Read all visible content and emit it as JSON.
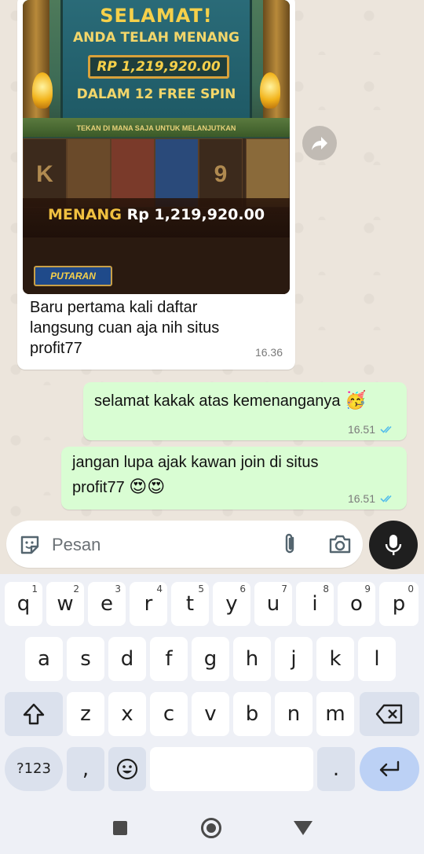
{
  "chat": {
    "incoming": {
      "image": {
        "headline": "SELAMAT!",
        "subtitle": "ANDA TELAH MENANG",
        "amount": "RP 1,219,920.00",
        "spins": "DALAM 12 FREE SPIN",
        "tap_hint": "TEKAN DI MANA SAJA UNTUK MELANJUTKAN",
        "win_label": "MENANG",
        "win_amount": "Rp 1,219,920.00",
        "badge": "PUTARAN",
        "reel_symbols": [
          "K",
          "",
          "",
          "",
          "9",
          ""
        ]
      },
      "caption": "Baru pertama kali daftar langsung cuan aja nih situs profit77",
      "time": "16.36"
    },
    "outgoing": [
      {
        "text": "selamat kakak atas kemenanganya",
        "emoji": "🥳",
        "time": "16.51"
      },
      {
        "text": "jangan lupa ajak kawan join di situs profit77",
        "emoji": "😍😍",
        "time": "16.51"
      }
    ]
  },
  "input": {
    "placeholder": "Pesan"
  },
  "keyboard": {
    "row1": [
      {
        "label": "q",
        "hint": "1"
      },
      {
        "label": "w",
        "hint": "2"
      },
      {
        "label": "e",
        "hint": "3"
      },
      {
        "label": "r",
        "hint": "4"
      },
      {
        "label": "t",
        "hint": "5"
      },
      {
        "label": "y",
        "hint": "6"
      },
      {
        "label": "u",
        "hint": "7"
      },
      {
        "label": "i",
        "hint": "8"
      },
      {
        "label": "o",
        "hint": "9"
      },
      {
        "label": "p",
        "hint": "0"
      }
    ],
    "row2": [
      "a",
      "s",
      "d",
      "f",
      "g",
      "h",
      "j",
      "k",
      "l"
    ],
    "row3": [
      "z",
      "x",
      "c",
      "v",
      "b",
      "n",
      "m"
    ],
    "symbols_label": "?123",
    "comma": ",",
    "period": "."
  },
  "colors": {
    "outgoing_bubble": "#d9fdd3",
    "incoming_bubble": "#ffffff",
    "read_ticks": "#53bdeb",
    "mic_button": "#1f1f1f",
    "enter_key": "#bcd1f5"
  }
}
